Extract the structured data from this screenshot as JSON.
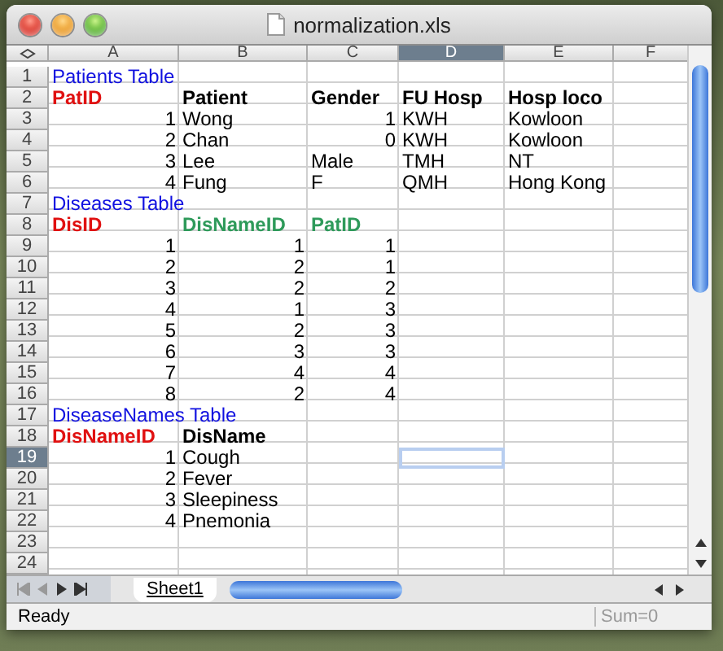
{
  "window": {
    "title": "normalization.xls"
  },
  "columns": [
    {
      "label": "A",
      "selected": false
    },
    {
      "label": "B",
      "selected": false
    },
    {
      "label": "C",
      "selected": false
    },
    {
      "label": "D",
      "selected": true
    },
    {
      "label": "E",
      "selected": false
    },
    {
      "label": "F",
      "selected": false
    }
  ],
  "rows": [
    {
      "label": "1",
      "selected": false,
      "cells": [
        {
          "text": "Patients Table",
          "kind": "title"
        }
      ]
    },
    {
      "label": "2",
      "selected": false,
      "cells": [
        {
          "text": "PatID",
          "kind": "key"
        },
        {
          "text": "Patient",
          "kind": "header"
        },
        {
          "text": "Gender",
          "kind": "header"
        },
        {
          "text": "FU Hosp",
          "kind": "header"
        },
        {
          "text": "Hosp loco",
          "kind": "header"
        }
      ]
    },
    {
      "label": "3",
      "selected": false,
      "cells": [
        {
          "text": "1",
          "kind": "number"
        },
        {
          "text": "Wong",
          "kind": "text"
        },
        {
          "text": "1",
          "kind": "number"
        },
        {
          "text": "KWH",
          "kind": "text"
        },
        {
          "text": "Kowloon",
          "kind": "text"
        }
      ]
    },
    {
      "label": "4",
      "selected": false,
      "cells": [
        {
          "text": "2",
          "kind": "number"
        },
        {
          "text": "Chan",
          "kind": "text"
        },
        {
          "text": "0",
          "kind": "number"
        },
        {
          "text": "KWH",
          "kind": "text"
        },
        {
          "text": "Kowloon",
          "kind": "text"
        }
      ]
    },
    {
      "label": "5",
      "selected": false,
      "cells": [
        {
          "text": "3",
          "kind": "number"
        },
        {
          "text": "Lee",
          "kind": "text"
        },
        {
          "text": "Male",
          "kind": "text"
        },
        {
          "text": "TMH",
          "kind": "text"
        },
        {
          "text": "NT",
          "kind": "text"
        }
      ]
    },
    {
      "label": "6",
      "selected": false,
      "cells": [
        {
          "text": "4",
          "kind": "number"
        },
        {
          "text": "Fung",
          "kind": "text"
        },
        {
          "text": "F",
          "kind": "text"
        },
        {
          "text": "QMH",
          "kind": "text"
        },
        {
          "text": "Hong Kong",
          "kind": "text"
        }
      ]
    },
    {
      "label": "7",
      "selected": false,
      "cells": [
        {
          "text": "Diseases Table",
          "kind": "title"
        }
      ]
    },
    {
      "label": "8",
      "selected": false,
      "cells": [
        {
          "text": "DisID",
          "kind": "key"
        },
        {
          "text": "DisNameID",
          "kind": "foreign"
        },
        {
          "text": "PatID",
          "kind": "foreign"
        }
      ]
    },
    {
      "label": "9",
      "selected": false,
      "cells": [
        {
          "text": "1",
          "kind": "number"
        },
        {
          "text": "1",
          "kind": "number"
        },
        {
          "text": "1",
          "kind": "number"
        }
      ]
    },
    {
      "label": "10",
      "selected": false,
      "cells": [
        {
          "text": "2",
          "kind": "number"
        },
        {
          "text": "2",
          "kind": "number"
        },
        {
          "text": "1",
          "kind": "number"
        }
      ]
    },
    {
      "label": "11",
      "selected": false,
      "cells": [
        {
          "text": "3",
          "kind": "number"
        },
        {
          "text": "2",
          "kind": "number"
        },
        {
          "text": "2",
          "kind": "number"
        }
      ]
    },
    {
      "label": "12",
      "selected": false,
      "cells": [
        {
          "text": "4",
          "kind": "number"
        },
        {
          "text": "1",
          "kind": "number"
        },
        {
          "text": "3",
          "kind": "number"
        }
      ]
    },
    {
      "label": "13",
      "selected": false,
      "cells": [
        {
          "text": "5",
          "kind": "number"
        },
        {
          "text": "2",
          "kind": "number"
        },
        {
          "text": "3",
          "kind": "number"
        }
      ]
    },
    {
      "label": "14",
      "selected": false,
      "cells": [
        {
          "text": "6",
          "kind": "number"
        },
        {
          "text": "3",
          "kind": "number"
        },
        {
          "text": "3",
          "kind": "number"
        }
      ]
    },
    {
      "label": "15",
      "selected": false,
      "cells": [
        {
          "text": "7",
          "kind": "number"
        },
        {
          "text": "4",
          "kind": "number"
        },
        {
          "text": "4",
          "kind": "number"
        }
      ]
    },
    {
      "label": "16",
      "selected": false,
      "cells": [
        {
          "text": "8",
          "kind": "number"
        },
        {
          "text": "2",
          "kind": "number"
        },
        {
          "text": "4",
          "kind": "number"
        }
      ]
    },
    {
      "label": "17",
      "selected": false,
      "cells": [
        {
          "text": "DiseaseNames Table",
          "kind": "title"
        }
      ]
    },
    {
      "label": "18",
      "selected": false,
      "cells": [
        {
          "text": "DisNameID",
          "kind": "key"
        },
        {
          "text": "DisName",
          "kind": "header"
        }
      ]
    },
    {
      "label": "19",
      "selected": true,
      "cells": [
        {
          "text": "1",
          "kind": "number"
        },
        {
          "text": "Cough",
          "kind": "text"
        }
      ]
    },
    {
      "label": "20",
      "selected": false,
      "cells": [
        {
          "text": "2",
          "kind": "number"
        },
        {
          "text": "Fever",
          "kind": "text"
        }
      ]
    },
    {
      "label": "21",
      "selected": false,
      "cells": [
        {
          "text": "3",
          "kind": "number"
        },
        {
          "text": "Sleepiness",
          "kind": "text"
        }
      ]
    },
    {
      "label": "22",
      "selected": false,
      "cells": [
        {
          "text": "4",
          "kind": "number"
        },
        {
          "text": "Pnemonia",
          "kind": "text"
        }
      ]
    },
    {
      "label": "23",
      "selected": false,
      "cells": []
    },
    {
      "label": "24",
      "selected": false,
      "cells": []
    }
  ],
  "sheet_tabs": [
    {
      "label": "Sheet1",
      "selected": true
    }
  ],
  "status_bar": {
    "status": "Ready",
    "sum": "Sum=0"
  }
}
